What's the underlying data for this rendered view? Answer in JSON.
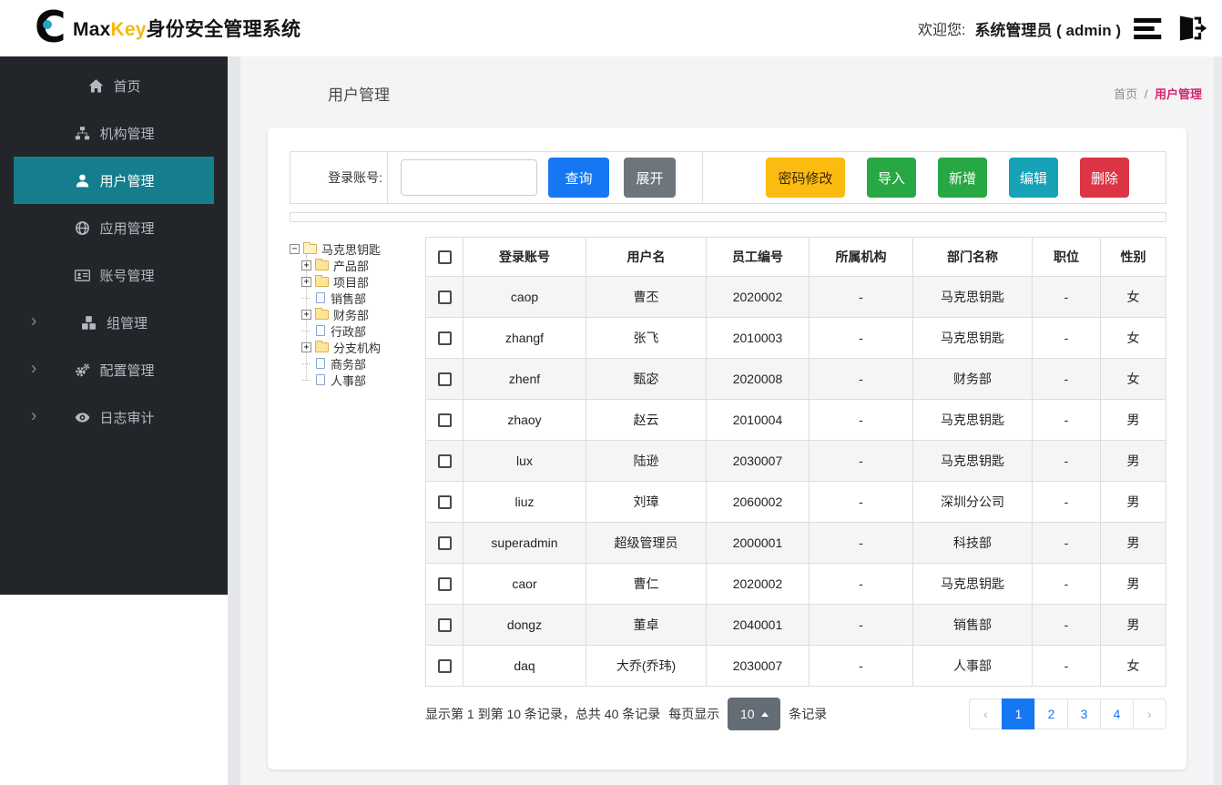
{
  "header": {
    "brand_black": "Max",
    "brand_gold": "Key",
    "brand_suffix": "身份安全管理系统",
    "welcome_label": "欢迎您:",
    "username": "系统管理员 ( admin )"
  },
  "sidebar": {
    "items": [
      {
        "key": "home",
        "label": "首页",
        "icon": "home-icon",
        "active": false,
        "expandable": false
      },
      {
        "key": "org",
        "label": "机构管理",
        "icon": "sitemap-icon",
        "active": false,
        "expandable": false
      },
      {
        "key": "user",
        "label": "用户管理",
        "icon": "user-icon",
        "active": true,
        "expandable": false
      },
      {
        "key": "app",
        "label": "应用管理",
        "icon": "globe-icon",
        "active": false,
        "expandable": false
      },
      {
        "key": "account",
        "label": "账号管理",
        "icon": "id-card-icon",
        "active": false,
        "expandable": false
      },
      {
        "key": "group",
        "label": "组管理",
        "icon": "cubes-icon",
        "active": false,
        "expandable": true
      },
      {
        "key": "config",
        "label": "配置管理",
        "icon": "gears-icon",
        "active": false,
        "expandable": true
      },
      {
        "key": "audit",
        "label": "日志审计",
        "icon": "eye-icon",
        "active": false,
        "expandable": true
      }
    ]
  },
  "page": {
    "title": "用户管理",
    "breadcrumb_home": "首页",
    "breadcrumb_sep": "/",
    "breadcrumb_current": "用户管理"
  },
  "toolbar": {
    "search_label": "登录账号:",
    "search_value": "",
    "buttons": {
      "query": "查询",
      "expand": "展开",
      "password": "密码修改",
      "import": "导入",
      "add": "新增",
      "edit": "编辑",
      "delete": "删除"
    }
  },
  "tree": {
    "root": {
      "label": "马克思钥匙",
      "type": "folder-open",
      "toggle": "minus"
    },
    "children": [
      {
        "label": "产品部",
        "type": "folder",
        "toggle": "plus"
      },
      {
        "label": "项目部",
        "type": "folder",
        "toggle": "plus"
      },
      {
        "label": "销售部",
        "type": "file",
        "toggle": "none"
      },
      {
        "label": "财务部",
        "type": "folder",
        "toggle": "plus"
      },
      {
        "label": "行政部",
        "type": "file",
        "toggle": "none"
      },
      {
        "label": "分支机构",
        "type": "folder",
        "toggle": "plus"
      },
      {
        "label": "商务部",
        "type": "file",
        "toggle": "none"
      },
      {
        "label": "人事部",
        "type": "file",
        "toggle": "none"
      }
    ]
  },
  "table": {
    "columns": [
      "登录账号",
      "用户名",
      "员工编号",
      "所属机构",
      "部门名称",
      "职位",
      "性别"
    ],
    "rows": [
      {
        "login": "caop",
        "name": "曹丕",
        "emp_no": "2020002",
        "org": "-",
        "dept": "马克思钥匙",
        "position": "-",
        "gender": "女"
      },
      {
        "login": "zhangf",
        "name": "张飞",
        "emp_no": "2010003",
        "org": "-",
        "dept": "马克思钥匙",
        "position": "-",
        "gender": "女"
      },
      {
        "login": "zhenf",
        "name": "甄宓",
        "emp_no": "2020008",
        "org": "-",
        "dept": "财务部",
        "position": "-",
        "gender": "女"
      },
      {
        "login": "zhaoy",
        "name": "赵云",
        "emp_no": "2010004",
        "org": "-",
        "dept": "马克思钥匙",
        "position": "-",
        "gender": "男"
      },
      {
        "login": "lux",
        "name": "陆逊",
        "emp_no": "2030007",
        "org": "-",
        "dept": "马克思钥匙",
        "position": "-",
        "gender": "男"
      },
      {
        "login": "liuz",
        "name": "刘璋",
        "emp_no": "2060002",
        "org": "-",
        "dept": "深圳分公司",
        "position": "-",
        "gender": "男"
      },
      {
        "login": "superadmin",
        "name": "超级管理员",
        "emp_no": "2000001",
        "org": "-",
        "dept": "科技部",
        "position": "-",
        "gender": "男"
      },
      {
        "login": "caor",
        "name": "曹仁",
        "emp_no": "2020002",
        "org": "-",
        "dept": "马克思钥匙",
        "position": "-",
        "gender": "男"
      },
      {
        "login": "dongz",
        "name": "董卓",
        "emp_no": "2040001",
        "org": "-",
        "dept": "销售部",
        "position": "-",
        "gender": "男"
      },
      {
        "login": "daq",
        "name": "大乔(乔玮)",
        "emp_no": "2030007",
        "org": "-",
        "dept": "人事部",
        "position": "-",
        "gender": "女"
      }
    ]
  },
  "pagination": {
    "info": "显示第 1 到第 10 条记录，总共 40 条记录",
    "per_page_label": "每页显示",
    "page_size": "10",
    "per_page_suffix": "条记录",
    "prev": "‹",
    "next": "›",
    "pages": [
      "1",
      "2",
      "3",
      "4"
    ],
    "active_page": "1"
  },
  "colors": {
    "sidebar_bg": "#22262a",
    "sidebar_active": "#157e8e",
    "primary_blue": "#1677f2",
    "warning_yellow": "#fcbb10",
    "success_green": "#28a745",
    "info_teal": "#17a2b8",
    "danger_red": "#dc3545",
    "breadcrumb_pink": "#d6246e",
    "brand_gold": "#f5b90a"
  }
}
